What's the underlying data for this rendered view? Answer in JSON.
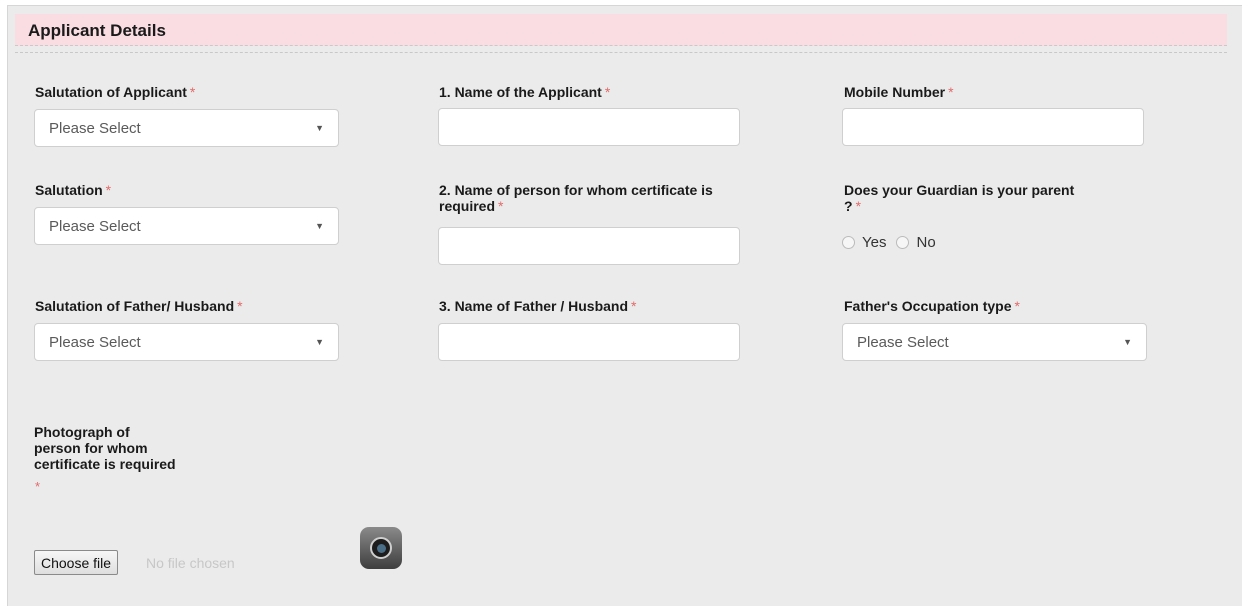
{
  "section": {
    "title": "Applicant Details"
  },
  "required_mark": "*",
  "fields": {
    "salutation_applicant": {
      "label": "Salutation of Applicant",
      "value": "Please Select"
    },
    "name_applicant": {
      "label": "1. Name of the Applicant",
      "value": ""
    },
    "mobile": {
      "label": "Mobile Number",
      "value": ""
    },
    "salutation": {
      "label": "Salutation",
      "value": "Please Select"
    },
    "name_person": {
      "label_line1": "2. Name of person for whom certificate is",
      "label_line2": "required",
      "value": ""
    },
    "guardian": {
      "label_line1": "Does your Guardian is your parent",
      "label_line2": "?",
      "options": [
        "Yes",
        "No"
      ]
    },
    "salutation_father": {
      "label": "Salutation of Father/ Husband",
      "value": "Please Select"
    },
    "name_father": {
      "label": "3. Name of Father / Husband",
      "value": ""
    },
    "father_occupation": {
      "label": "Father's Occupation type",
      "value": "Please Select"
    },
    "photo": {
      "label_line1": "Photograph of",
      "label_line2": "person for whom",
      "label_line3": "certificate is required",
      "button_label": "Choose file",
      "status": "No file chosen"
    }
  },
  "icons": {
    "caret": "▼",
    "camera": "camera-icon"
  },
  "colors": {
    "header_bg": "#fadde3",
    "required": "#e26a6a",
    "panel_bg": "#ebebeb"
  }
}
